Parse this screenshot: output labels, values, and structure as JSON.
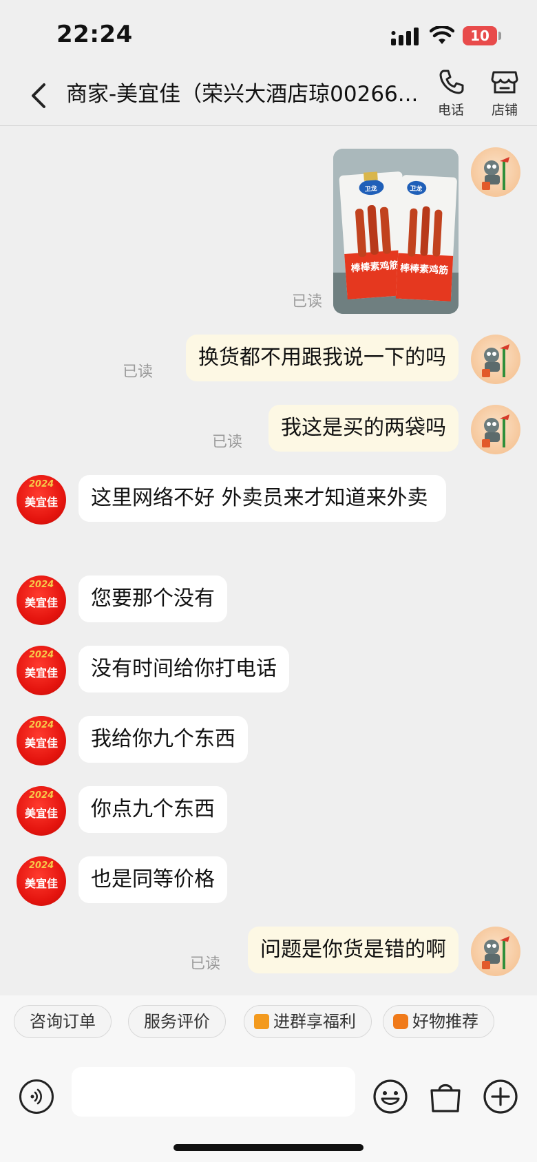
{
  "status_bar": {
    "time": "22:24",
    "battery": "10"
  },
  "header": {
    "title": "商家-美宜佳（荣兴大酒店琼00266...",
    "phone_label": "电话",
    "shop_label": "店铺"
  },
  "product_image": {
    "brand_mark": "卫龙",
    "product_name": "棒棒素鸡筋"
  },
  "shop_avatar": {
    "label": "美宜佳",
    "year": "2024"
  },
  "messages": [
    {
      "from": "user",
      "type": "image",
      "read": "已读"
    },
    {
      "from": "user",
      "type": "text",
      "text": "换货都不用跟我说一下的吗",
      "read": "已读"
    },
    {
      "from": "user",
      "type": "text",
      "text": "我这是买的两袋吗",
      "read": "已读"
    },
    {
      "from": "shop",
      "type": "text",
      "text": "这里网络不好 外卖员来才知道来外卖"
    },
    {
      "from": "shop",
      "type": "text",
      "text": "您要那个没有"
    },
    {
      "from": "shop",
      "type": "text",
      "text": "没有时间给你打电话"
    },
    {
      "from": "shop",
      "type": "text",
      "text": "我给你九个东西"
    },
    {
      "from": "shop",
      "type": "text",
      "text": "你点九个东西"
    },
    {
      "from": "shop",
      "type": "text",
      "text": "也是同等价格"
    },
    {
      "from": "user",
      "type": "text",
      "text": "问题是你货是错的啊",
      "read": "已读"
    }
  ],
  "quick_actions": [
    {
      "label": "咨询订单",
      "icon": ""
    },
    {
      "label": "服务评价",
      "icon": ""
    },
    {
      "label": "进群享福利",
      "icon": "group-icon",
      "icon_color": "#f39a1e"
    },
    {
      "label": "好物推荐",
      "icon": "bag-icon",
      "icon_color": "#f07a1a"
    }
  ],
  "input": {
    "placeholder": ""
  },
  "icons": {
    "back": "chevron-left-icon",
    "phone": "phone-icon",
    "shop": "shop-icon",
    "voice": "voice-icon",
    "emoji": "emoji-icon",
    "bag": "shopping-bag-icon",
    "plus": "plus-icon"
  }
}
